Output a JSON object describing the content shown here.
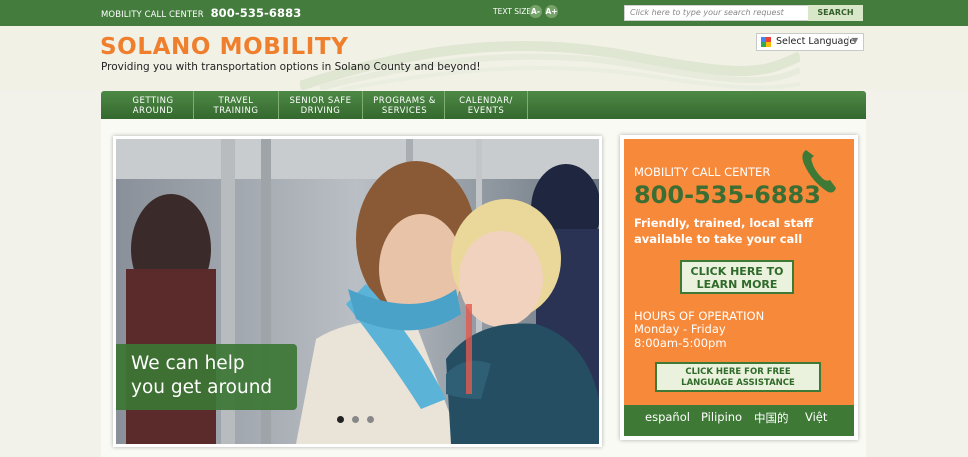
{
  "topbar": {
    "call_center_label": "MOBILITY CALL CENTER",
    "call_center_number": "800-535-6883",
    "text_size_label": "TEXT SIZE",
    "text_size_decrease": "A-",
    "text_size_increase": "A+",
    "search_placeholder": "Click here to type your search request",
    "search_button": "SEARCH"
  },
  "header": {
    "logo": "SOLANO MOBILITY",
    "tagline": "Providing you with transportation options in Solano County and beyond!",
    "language_select": "Select Language"
  },
  "nav": {
    "items": [
      {
        "line1": "GETTING",
        "line2": "AROUND"
      },
      {
        "line1": "TRAVEL",
        "line2": "TRAINING"
      },
      {
        "line1": "SENIOR SAFE",
        "line2": "DRIVING"
      },
      {
        "line1": "PROGRAMS &",
        "line2": "SERVICES"
      },
      {
        "line1": "CALENDAR/",
        "line2": "EVENTS"
      }
    ]
  },
  "hero": {
    "caption_line1": "We can help",
    "caption_line2": "you get around",
    "active_slide": 1,
    "slide_count": 3
  },
  "call_panel": {
    "title": "MOBILITY CALL CENTER",
    "number": "800-535-6883",
    "description": "Friendly, trained, local staff available to take your call",
    "learn_more_line1": "CLICK HERE TO",
    "learn_more_line2": "LEARN MORE",
    "hours_heading": "HOURS OF OPERATION",
    "hours_days": "Monday - Friday",
    "hours_time": "8:00am-5:00pm",
    "language_button_line1": "CLICK HERE FOR FREE",
    "language_button_line2": "LANGUAGE ASSISTANCE",
    "languages": [
      "español",
      "Pilipino",
      "中国的",
      "Việt"
    ]
  },
  "colors": {
    "brand_green": "#447c3e",
    "brand_orange": "#ef7f2d",
    "panel_orange": "#f7893a"
  }
}
